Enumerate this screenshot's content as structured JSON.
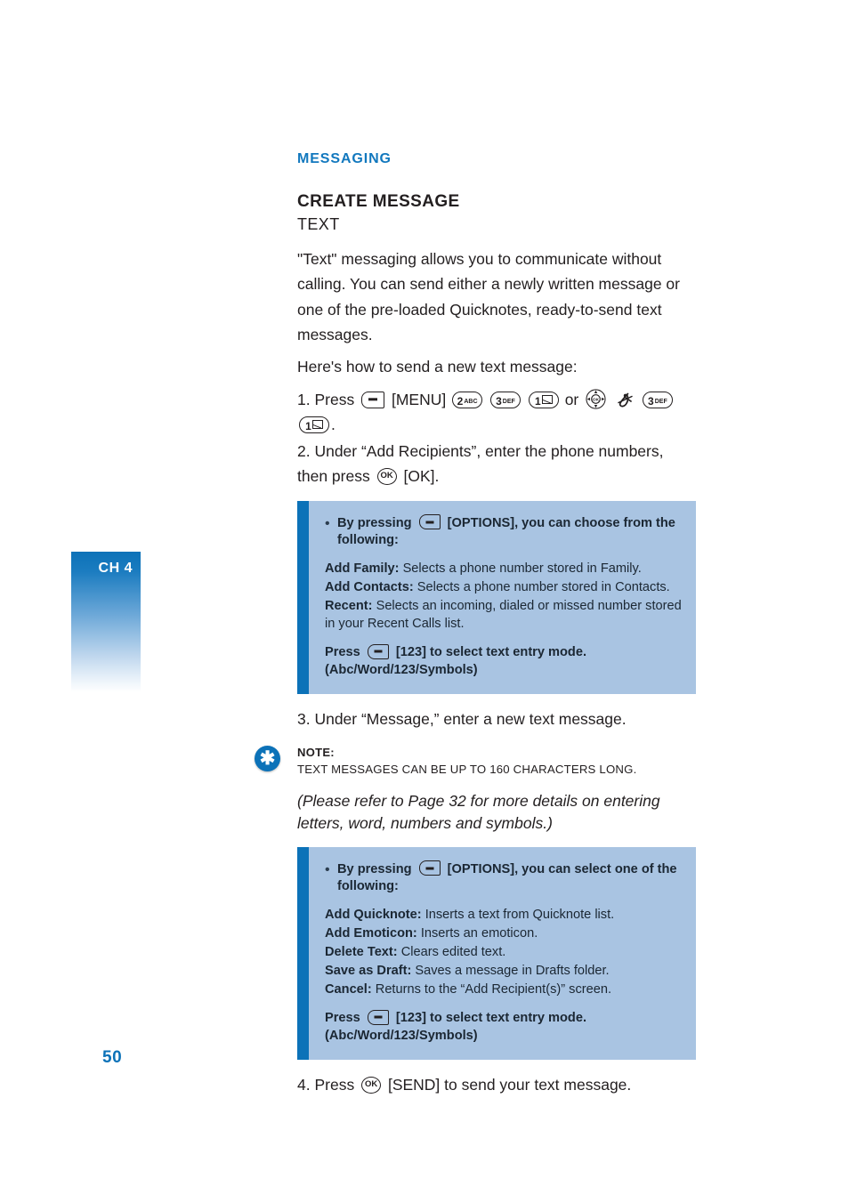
{
  "chapter_tab": {
    "label": "CH 4"
  },
  "page_number": "50",
  "section_title": "MESSAGING",
  "headings": {
    "h1": "CREATE MESSAGE",
    "h2": "TEXT"
  },
  "intro_paragraph": "\"Text\" messaging allows you to communicate without calling. You can send either a newly written message or one of the pre-loaded Quicknotes, ready-to-send text messages.",
  "intro_lead": "Here's how to send a new text message:",
  "steps": {
    "step1": {
      "prefix": "1. Press",
      "menu_label": "[MENU]",
      "keys_a": [
        {
          "num": "2",
          "sub": "ABC"
        },
        {
          "num": "3",
          "sub": "DEF"
        },
        {
          "num": "1",
          "sub": "envelope"
        }
      ],
      "or": "or",
      "keys_b": [
        {
          "num": "3",
          "sub": "DEF"
        },
        {
          "num": "1",
          "sub": "envelope"
        }
      ],
      "suffix": "."
    },
    "step2": {
      "line1": "2. Under “Add Recipients”, enter the phone numbers,",
      "line2_prefix": "then press",
      "ok_key": "OK",
      "line2_suffix": "[OK]."
    },
    "step3": "3. Under “Message,” enter a new text message.",
    "step4": {
      "prefix": "4. Press",
      "ok_key": "OK",
      "suffix": "[SEND] to send your text message."
    }
  },
  "callout_1": {
    "bullet": "•",
    "lead_prefix": "By pressing",
    "lead_suffix": "[OPTIONS], you can choose from the following:",
    "options": [
      {
        "term": "Add Family:",
        "desc": " Selects a phone number stored in Family."
      },
      {
        "term": "Add Contacts:",
        "desc": " Selects a phone number stored in Contacts."
      },
      {
        "term": "Recent:",
        "desc": " Selects an incoming, dialed or missed number stored in your Recent Calls list."
      }
    ],
    "press_prefix": "Press",
    "press_suffix": "[123] to select text entry mode. (Abc/Word/123/Symbols)"
  },
  "note": {
    "icon": "asterisk-icon",
    "glyph": "✱",
    "label": "NOTE:",
    "text": "TEXT MESSAGES CAN BE UP TO 160 CHARACTERS LONG."
  },
  "italic_note": "(Please refer to Page 32 for more details on entering letters, word, numbers and symbols.)",
  "callout_2": {
    "bullet": "•",
    "lead_prefix": "By pressing",
    "lead_suffix": "[OPTIONS], you can select one of the following:",
    "options": [
      {
        "term": "Add Quicknote:",
        "desc": " Inserts a text from Quicknote list."
      },
      {
        "term": "Add Emoticon:",
        "desc": " Inserts an emoticon."
      },
      {
        "term": "Delete Text:",
        "desc": " Clears edited text."
      },
      {
        "term": "Save as Draft:",
        "desc": " Saves a message in Drafts folder."
      },
      {
        "term": "Cancel:",
        "desc": " Returns to the “Add Recipient(s)” screen."
      }
    ],
    "press_prefix": "Press",
    "press_suffix": "[123] to select text entry mode. (Abc/Word/123/Symbols)"
  },
  "colors": {
    "accent_blue": "#1278be",
    "callout_bar": "#0c72b8",
    "callout_bg": "#a9c4e2",
    "text": "#231f20"
  }
}
